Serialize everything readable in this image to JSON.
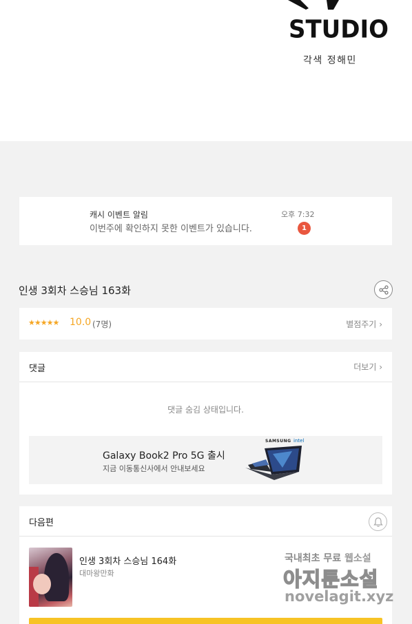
{
  "header": {
    "logo_text": "STUDIO",
    "credit": "각색 정해민"
  },
  "notification": {
    "title": "캐시 이벤트 알림",
    "message": "이번주에 확인하지 못한 이벤트가 있습니다.",
    "time": "오후 7:32",
    "badge_count": "1"
  },
  "episode": {
    "title": "인생 3회차 스승님 163화",
    "share_icon": "share-icon"
  },
  "rating": {
    "stars": "★★★★★",
    "score": "10.0",
    "count": "(7명)",
    "rate_link": "별점주기",
    "accent_color": "#f5a623"
  },
  "comments": {
    "title": "댓글",
    "more_link": "더보기",
    "hidden_message": "댓글 숨김 상태입니다."
  },
  "ad": {
    "title": "Galaxy Book2 Pro 5G 출시",
    "subtitle": "지금 이동통신사에서 안내보세요",
    "brand": "SAMSUNG",
    "brand2": "intel"
  },
  "next_episode": {
    "section_title": "다음편",
    "title": "인생 3회차 스승님 164화",
    "author": "대마왕만화",
    "bell_icon": "bell-icon",
    "cta_color": "#f7c325"
  },
  "watermark": {
    "line1_prefix": "국내최초 무료",
    "line1_highlight": "웹소설",
    "line2": "아지툰소설",
    "line3": "novelagit.xyz"
  }
}
